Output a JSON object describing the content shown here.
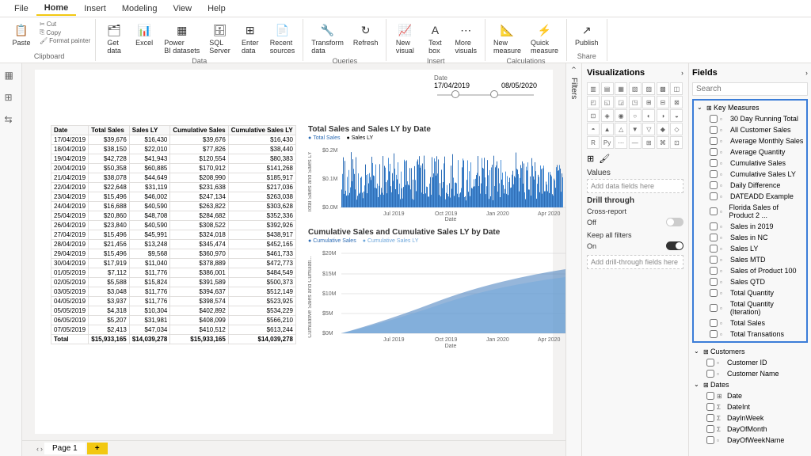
{
  "menu": {
    "items": [
      "File",
      "Home",
      "Insert",
      "Modeling",
      "View",
      "Help"
    ],
    "active": "Home"
  },
  "ribbon": {
    "clipboard": {
      "paste": "Paste",
      "cut": "Cut",
      "copy": "Copy",
      "format": "Format painter",
      "label": "Clipboard"
    },
    "data": {
      "items": [
        "Get data",
        "Excel",
        "Power BI datasets",
        "SQL Server",
        "Enter data",
        "Recent sources"
      ],
      "label": "Data"
    },
    "queries": {
      "items": [
        "Transform data",
        "Refresh"
      ],
      "label": "Queries"
    },
    "insert": {
      "items": [
        "New visual",
        "Text box",
        "More visuals"
      ],
      "label": "Insert"
    },
    "calc": {
      "items": [
        "New measure",
        "Quick measure"
      ],
      "label": "Calculations"
    },
    "share": {
      "items": [
        "Publish"
      ],
      "label": "Share"
    }
  },
  "slicer": {
    "label": "Date",
    "from": "17/04/2019",
    "to": "08/05/2020"
  },
  "table": {
    "headers": [
      "Date",
      "Total Sales",
      "Sales LY",
      "Cumulative Sales",
      "Cumulative Sales LY"
    ],
    "rows": [
      [
        "17/04/2019",
        "$39,676",
        "$16,430",
        "$39,676",
        "$16,430"
      ],
      [
        "18/04/2019",
        "$38,150",
        "$22,010",
        "$77,826",
        "$38,440"
      ],
      [
        "19/04/2019",
        "$42,728",
        "$41,943",
        "$120,554",
        "$80,383"
      ],
      [
        "20/04/2019",
        "$50,358",
        "$60,885",
        "$170,912",
        "$141,268"
      ],
      [
        "21/04/2019",
        "$38,078",
        "$44,649",
        "$208,990",
        "$185,917"
      ],
      [
        "22/04/2019",
        "$22,648",
        "$31,119",
        "$231,638",
        "$217,036"
      ],
      [
        "23/04/2019",
        "$15,496",
        "$46,002",
        "$247,134",
        "$263,038"
      ],
      [
        "24/04/2019",
        "$16,688",
        "$40,590",
        "$263,822",
        "$303,628"
      ],
      [
        "25/04/2019",
        "$20,860",
        "$48,708",
        "$284,682",
        "$352,336"
      ],
      [
        "26/04/2019",
        "$23,840",
        "$40,590",
        "$308,522",
        "$392,926"
      ],
      [
        "27/04/2019",
        "$15,496",
        "$45,991",
        "$324,018",
        "$438,917"
      ],
      [
        "28/04/2019",
        "$21,456",
        "$13,248",
        "$345,474",
        "$452,165"
      ],
      [
        "29/04/2019",
        "$15,496",
        "$9,568",
        "$360,970",
        "$461,733"
      ],
      [
        "30/04/2019",
        "$17,919",
        "$11,040",
        "$378,889",
        "$472,773"
      ],
      [
        "01/05/2019",
        "$7,112",
        "$11,776",
        "$386,001",
        "$484,549"
      ],
      [
        "02/05/2019",
        "$5,588",
        "$15,824",
        "$391,589",
        "$500,373"
      ],
      [
        "03/05/2019",
        "$3,048",
        "$11,776",
        "$394,637",
        "$512,149"
      ],
      [
        "04/05/2019",
        "$3,937",
        "$11,776",
        "$398,574",
        "$523,925"
      ],
      [
        "05/05/2019",
        "$4,318",
        "$10,304",
        "$402,892",
        "$534,229"
      ],
      [
        "06/05/2019",
        "$5,207",
        "$31,981",
        "$408,099",
        "$566,210"
      ],
      [
        "07/05/2019",
        "$2,413",
        "$47,034",
        "$410,512",
        "$613,244"
      ]
    ],
    "total": [
      "Total",
      "$15,933,165",
      "$14,039,278",
      "$15,933,165",
      "$14,039,278"
    ]
  },
  "chart_data": [
    {
      "type": "bar",
      "title": "Total Sales and Sales LY by Date",
      "series": [
        {
          "name": "Total Sales",
          "color": "#2e6db5"
        },
        {
          "name": "Sales LY",
          "color": "#000"
        }
      ],
      "xlabel": "Date",
      "ylabel": "Total Sales and Sales LY",
      "ylim": [
        0,
        200000
      ],
      "yticks": [
        "$0.0M",
        "$0.1M",
        "$0.2M"
      ],
      "xticks": [
        "Jul 2019",
        "Oct 2019",
        "Jan 2020",
        "Apr 2020"
      ]
    },
    {
      "type": "area",
      "title": "Cumulative Sales and Cumulative Sales LY by Date",
      "series": [
        {
          "name": "Cumulative Sales",
          "color": "#2e6db5",
          "end": 15933165
        },
        {
          "name": "Cumulative Sales LY",
          "color": "#6fa8dc",
          "end": 14039278
        }
      ],
      "xlabel": "Date",
      "ylabel": "Cumulative Sales and Cumulati...",
      "ylim": [
        0,
        20000000
      ],
      "yticks": [
        "$0M",
        "$5M",
        "$10M",
        "$15M",
        "$20M"
      ],
      "xticks": [
        "Jul 2019",
        "Oct 2019",
        "Jan 2020",
        "Apr 2020"
      ]
    }
  ],
  "filters_label": "Filters",
  "viz_pane": {
    "title": "Visualizations",
    "values": "Values",
    "values_ph": "Add data fields here",
    "drill": "Drill through",
    "cross": "Cross-report",
    "off": "Off",
    "keep": "Keep all filters",
    "on": "On",
    "drill_ph": "Add drill-through fields here"
  },
  "fields_pane": {
    "title": "Fields",
    "search_ph": "Search",
    "key_measures": {
      "label": "Key Measures",
      "items": [
        "30 Day Running Total",
        "All Customer Sales",
        "Average Monthly Sales",
        "Average Quantity",
        "Cumulative Sales",
        "Cumulative Sales LY",
        "Daily Difference",
        "DATEADD Example",
        "Florida Sales of Product 2 ...",
        "Sales in 2019",
        "Sales in NC",
        "Sales LY",
        "Sales MTD",
        "Sales of Product 100",
        "Sales QTD",
        "Total Quantity",
        "Total Quantity (Iteration)",
        "Total Sales",
        "Total Transations"
      ]
    },
    "customers": {
      "label": "Customers",
      "items": [
        "Customer ID",
        "Customer Name"
      ]
    },
    "dates": {
      "label": "Dates",
      "items": [
        {
          "n": "Date",
          "i": "⊞"
        },
        {
          "n": "DateInt",
          "i": "Σ"
        },
        {
          "n": "DayInWeek",
          "i": "Σ"
        },
        {
          "n": "DayOfMonth",
          "i": "Σ"
        },
        {
          "n": "DayOfWeekName",
          "i": ""
        }
      ]
    }
  },
  "page": {
    "tab": "Page 1",
    "add": "+"
  }
}
